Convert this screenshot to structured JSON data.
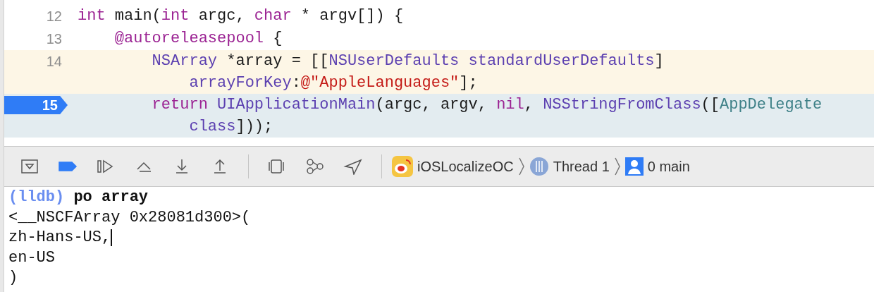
{
  "code": {
    "lines": [
      {
        "number": "12",
        "warning": false,
        "current": false,
        "rows": [
          {
            "tokens": [
              {
                "text": "int",
                "color": "#9b2393"
              },
              {
                "text": " main(",
                "color": "#1a1a1a"
              },
              {
                "text": "int",
                "color": "#9b2393"
              },
              {
                "text": " argc, ",
                "color": "#1a1a1a"
              },
              {
                "text": "char",
                "color": "#9b2393"
              },
              {
                "text": " * argv[]) {",
                "color": "#1a1a1a"
              }
            ]
          }
        ]
      },
      {
        "number": "13",
        "warning": false,
        "current": false,
        "rows": [
          {
            "tokens": [
              {
                "text": "    @autoreleasepool",
                "color": "#9b2393"
              },
              {
                "text": " {",
                "color": "#1a1a1a"
              }
            ]
          }
        ]
      },
      {
        "number": "14",
        "warning": true,
        "current": false,
        "rows": [
          {
            "tokens": [
              {
                "text": "        NSArray",
                "color": "#5b3fb0"
              },
              {
                "text": " *array = [[",
                "color": "#1a1a1a"
              },
              {
                "text": "NSUserDefaults standardUserDefaults",
                "color": "#5b3fb0"
              },
              {
                "text": "]",
                "color": "#1a1a1a"
              }
            ]
          },
          {
            "tokens": [
              {
                "text": "            arrayForKey",
                "color": "#5b3fb0"
              },
              {
                "text": ":",
                "color": "#1a1a1a"
              },
              {
                "text": "@\"AppleLanguages\"",
                "color": "#c41a16"
              },
              {
                "text": "];",
                "color": "#1a1a1a"
              }
            ]
          }
        ]
      },
      {
        "number": "15",
        "warning": false,
        "current": true,
        "rows": [
          {
            "tokens": [
              {
                "text": "        return",
                "color": "#9b2393"
              },
              {
                "text": " UIApplicationMain",
                "color": "#5b3fb0"
              },
              {
                "text": "(argc, argv, ",
                "color": "#1a1a1a"
              },
              {
                "text": "nil",
                "color": "#9b2393"
              },
              {
                "text": ", ",
                "color": "#1a1a1a"
              },
              {
                "text": "NSStringFromClass",
                "color": "#5b3fb0"
              },
              {
                "text": "([",
                "color": "#1a1a1a"
              },
              {
                "text": "AppDelegate",
                "color": "#3e8087"
              }
            ]
          },
          {
            "tokens": [
              {
                "text": "            class",
                "color": "#5b3fb0"
              },
              {
                "text": "]));",
                "color": "#1a1a1a"
              }
            ]
          }
        ]
      }
    ]
  },
  "toolbar": {
    "breakpoints_active": true,
    "app": "iOSLocalizeOC",
    "thread": "Thread 1",
    "frame": "0 main"
  },
  "console": {
    "prompt": "(lldb)",
    "command": "po array",
    "output": [
      {
        "text": "<__NSCFArray 0x28081d300>(",
        "cursor": false
      },
      {
        "text": "zh-Hans-US,",
        "cursor": true
      },
      {
        "text": "en-US",
        "cursor": false
      },
      {
        "text": ")",
        "cursor": false
      }
    ]
  }
}
